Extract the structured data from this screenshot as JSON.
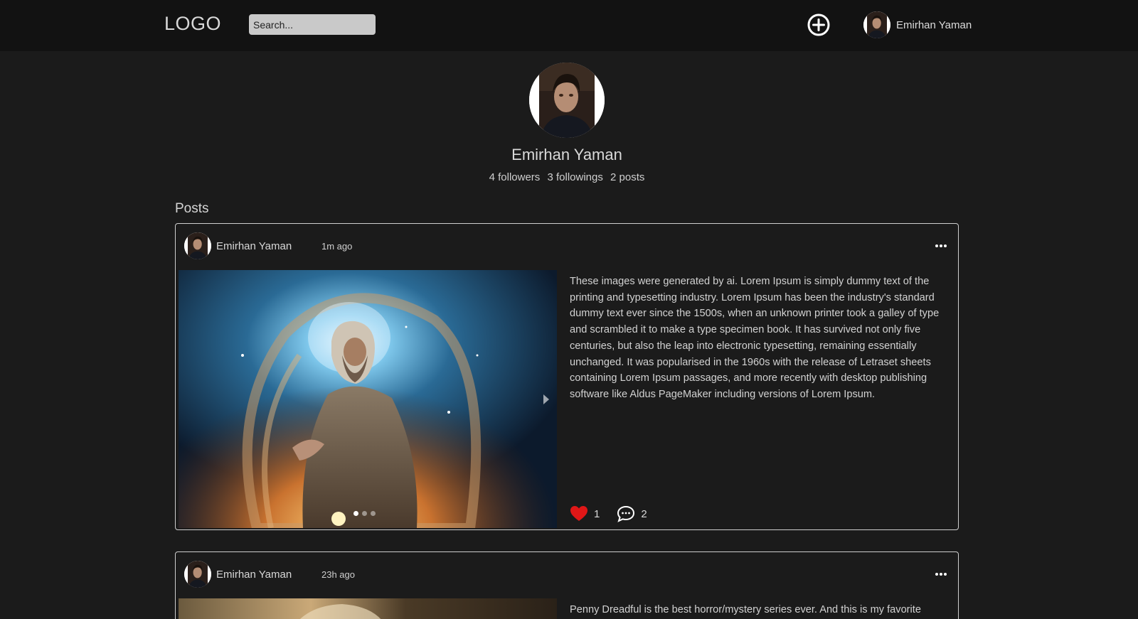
{
  "header": {
    "logo": "LOGO",
    "search_placeholder": "Search...",
    "user_name": "Emirhan Yaman",
    "add_icon": "plus-circle-icon"
  },
  "profile": {
    "name": "Emirhan Yaman",
    "followers": "4 followers",
    "followings": "3 followings",
    "posts": "2 posts"
  },
  "posts_heading": "Posts",
  "posts": [
    {
      "author": "Emirhan Yaman",
      "time": "1m ago",
      "text": "These images were generated by ai. Lorem Ipsum is simply dummy text of the printing and typesetting industry. Lorem Ipsum has been the industry's standard dummy text ever since the 1500s, when an unknown printer took a galley of type and scrambled it to make a type specimen book. It has survived not only five centuries, but also the leap into electronic typesetting, remaining essentially unchanged. It was popularised in the 1960s with the release of Letraset sheets containing Lorem Ipsum passages, and more recently with desktop publishing software like Aldus PageMaker including versions of Lorem Ipsum.",
      "likes": "1",
      "comments": "2",
      "carousel_count": 3,
      "carousel_active": 1
    },
    {
      "author": "Emirhan Yaman",
      "time": "23h ago",
      "text": "Penny Dreadful is the best horror/mystery series ever. And this is my favorite"
    }
  ],
  "colors": {
    "background": "#1b1b1b",
    "header": "#121212",
    "like": "#e01717"
  }
}
